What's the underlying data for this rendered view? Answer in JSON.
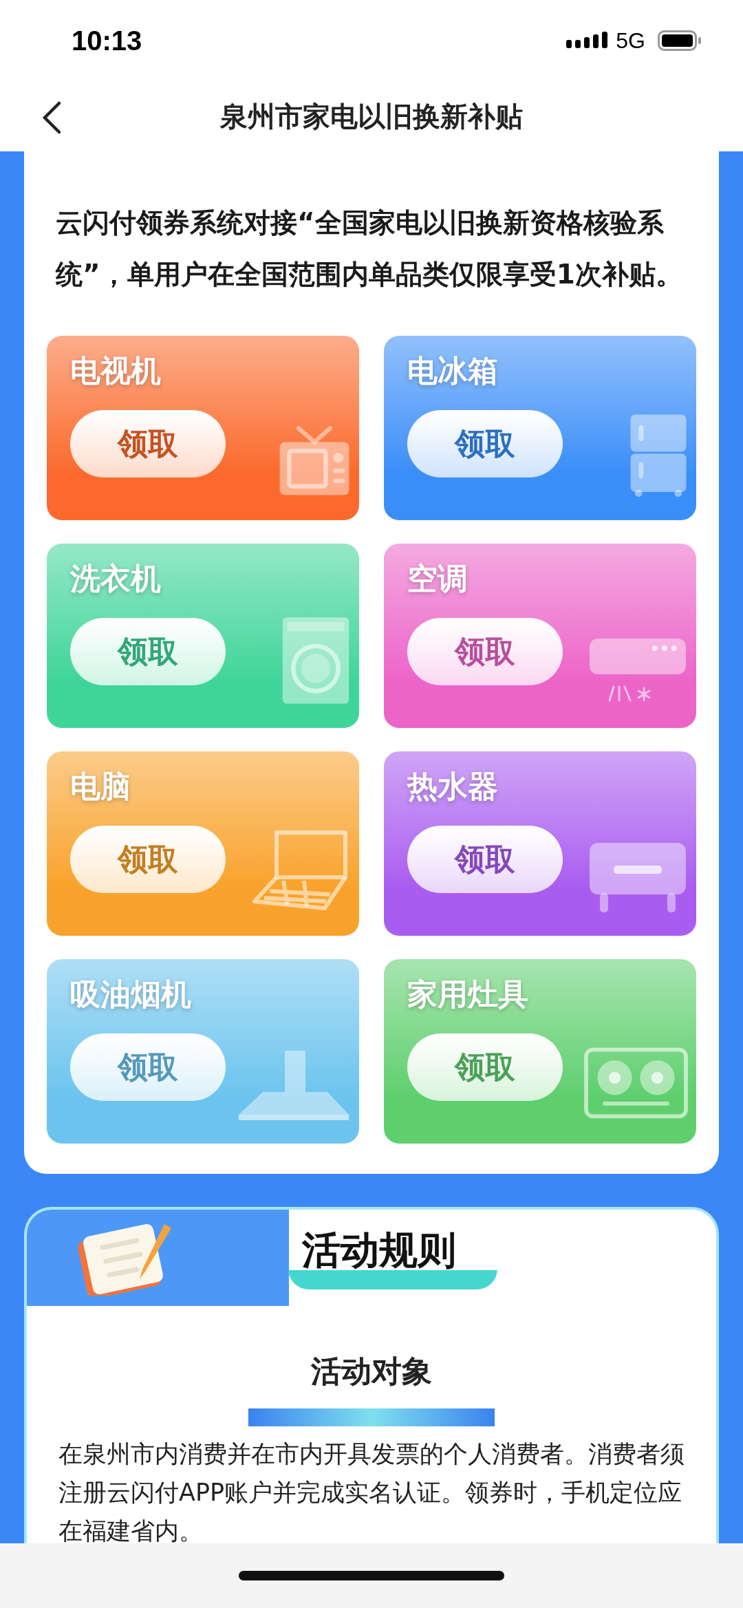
{
  "status_bar": {
    "time": "10:13",
    "network": "5G"
  },
  "nav": {
    "title": "泉州市家电以旧换新补贴"
  },
  "intro": "云闪付领券系统对接“全国家电以旧换新资格核验系统”，单用户在全国范围内单品类仅限享受1次补贴。",
  "tiles": [
    {
      "title": "电视机",
      "button": "领取",
      "color": "#fb6a2c",
      "kind": "tv"
    },
    {
      "title": "电冰箱",
      "button": "领取",
      "color": "#3a8ef8",
      "kind": "fridge"
    },
    {
      "title": "洗衣机",
      "button": "领取",
      "color": "#3fd598",
      "kind": "washer"
    },
    {
      "title": "空调",
      "button": "领取",
      "color": "#ec64c8",
      "kind": "ac"
    },
    {
      "title": "电脑",
      "button": "领取",
      "color": "#f9a22b",
      "kind": "laptop"
    },
    {
      "title": "热水器",
      "button": "领取",
      "color": "#a95cf0",
      "kind": "heater"
    },
    {
      "title": "吸油烟机",
      "button": "领取",
      "color": "#6cc4ee",
      "kind": "hood"
    },
    {
      "title": "家用灶具",
      "button": "领取",
      "color": "#5fcf6e",
      "kind": "stove"
    }
  ],
  "rules": {
    "title": "活动规则",
    "section_title": "活动对象",
    "text": "在泉州市内消费并在市内开具发票的个人消费者。消费者须注册云闪付APP账户并完成实名认证。领券时，手机定位应在福建省内。"
  }
}
